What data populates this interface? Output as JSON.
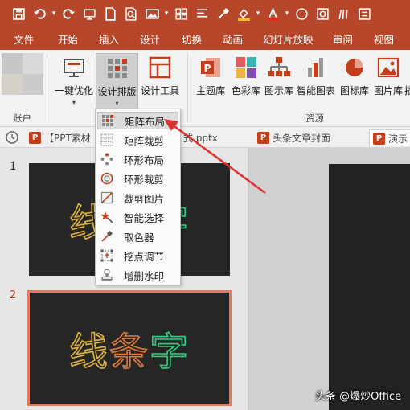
{
  "tabs": [
    "文件",
    "开始",
    "插入",
    "设计",
    "切换",
    "动画",
    "幻灯片放映",
    "审阅",
    "视图"
  ],
  "ribbon": {
    "account_group_label": "账户",
    "resources_group_label": "资源",
    "buttons": {
      "optimize": "一键优化",
      "design_layout": "设计排版",
      "design_tools": "设计工具",
      "theme_library": "主题库",
      "color_library": "色彩库",
      "diagram_library": "图示库",
      "smart_chart": "智能图表",
      "icon_library": "图标库",
      "picture_library": "图片库",
      "more": "插"
    },
    "dropdown_arrow": "▾"
  },
  "doc_tabs": {
    "tab1": "【PPT素材",
    "tab1_suffix": "式.pptx",
    "tab2": "头条文章封面",
    "tab3": "演示",
    "badge": "P"
  },
  "dropdown_menu": {
    "items": [
      "矩阵布局",
      "矩阵裁剪",
      "环形布局",
      "环形裁剪",
      "裁剪图片",
      "智能选择",
      "取色器",
      "挖点调节",
      "增删水印"
    ]
  },
  "slides": {
    "numbers": [
      "1",
      "2"
    ],
    "text_chars": [
      "线",
      "条",
      "字"
    ],
    "char_colors": [
      "#e0b33a",
      "#e07a3a",
      "#2ecf7e"
    ]
  },
  "colors": {
    "accent": "#b7472a",
    "selected_slide_border": "#e07b5f",
    "arrow": "#e03030"
  },
  "watermark": "头条 @爆炒Office"
}
